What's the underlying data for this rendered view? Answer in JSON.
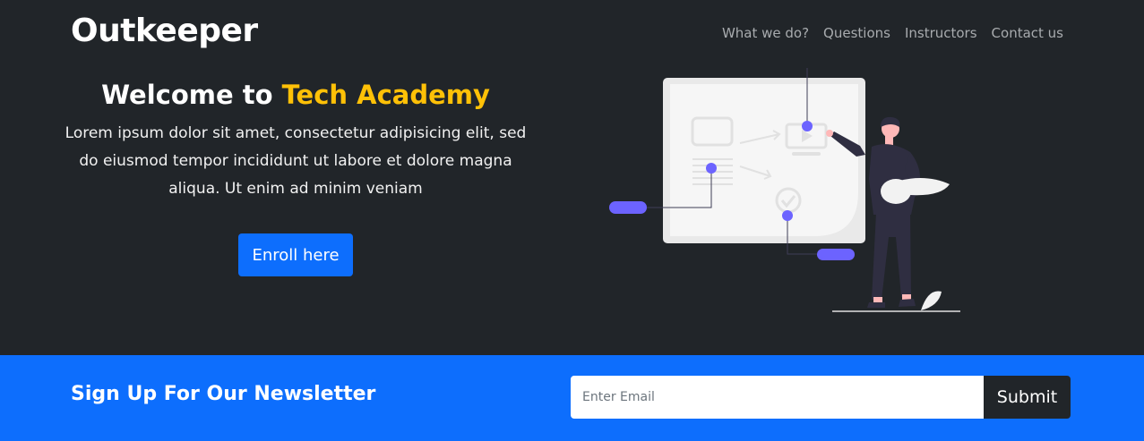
{
  "brand": {
    "name": "Outkeeper"
  },
  "nav": {
    "items": [
      {
        "label": "What we do?"
      },
      {
        "label": "Questions"
      },
      {
        "label": "Instructors"
      },
      {
        "label": "Contact us"
      }
    ]
  },
  "hero": {
    "headline_prefix": "Welcome to ",
    "headline_accent": "Tech Academy",
    "description": "Lorem ipsum dolor sit amet, consectetur adipisicing elit, sed do eiusmod tempor incididunt ut labore et dolore magna aliqua. Ut enim ad minim veniam",
    "cta_label": "Enroll here"
  },
  "newsletter": {
    "title": "Sign Up For Our Newsletter",
    "email_placeholder": "Enter Email",
    "email_value": "",
    "submit_label": "Submit"
  },
  "colors": {
    "dark_bg": "#212529",
    "primary": "#0d6efd",
    "accent": "#ffc107",
    "illustration_accent": "#6c63ff"
  }
}
